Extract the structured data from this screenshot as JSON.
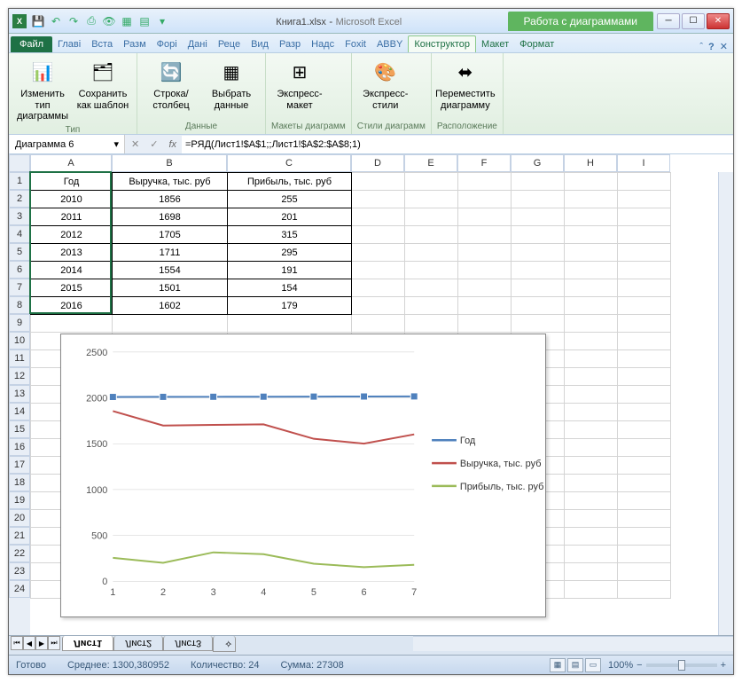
{
  "title": {
    "doc": "Книга1.xlsx",
    "app": "Microsoft Excel",
    "tools": "Работа с диаграммами"
  },
  "qat_icons": [
    "save-icon",
    "undo-icon",
    "redo-icon",
    "print-icon",
    "preview-icon",
    "new-icon",
    "open-icon",
    "more-icon"
  ],
  "tabs": {
    "file": "Файл",
    "list": [
      "Главі",
      "Вста",
      "Разм",
      "Форі",
      "Дані",
      "Реце",
      "Вид",
      "Разр",
      "Надс",
      "Foxit",
      "ABBY"
    ],
    "ctx": [
      "Конструктор",
      "Макет",
      "Формат"
    ]
  },
  "ribbon": {
    "g1": {
      "label": "Тип",
      "b1": "Изменить тип диаграммы",
      "b2": "Сохранить как шаблон"
    },
    "g2": {
      "label": "Данные",
      "b1": "Строка/столбец",
      "b2": "Выбрать данные"
    },
    "g3": {
      "label": "Макеты диаграмм",
      "b1": "Экспресс-макет"
    },
    "g4": {
      "label": "Стили диаграмм",
      "b1": "Экспресс-стили"
    },
    "g5": {
      "label": "Расположение",
      "b1": "Переместить диаграмму"
    }
  },
  "namebox": "Диаграмма 6",
  "formula": "=РЯД(Лист1!$A$1;;Лист1!$A$2:$A$8;1)",
  "columns": [
    "A",
    "B",
    "C",
    "D",
    "E",
    "F",
    "G",
    "H",
    "I"
  ],
  "rows": [
    "1",
    "2",
    "3",
    "4",
    "5",
    "6",
    "7",
    "8",
    "9",
    "10",
    "11",
    "12",
    "13",
    "14",
    "15",
    "16",
    "17",
    "18",
    "19",
    "20",
    "21",
    "22",
    "23",
    "24"
  ],
  "table": {
    "headers": [
      "Год",
      "Выручка, тыс. руб",
      "Прибыль, тыс. руб"
    ],
    "rows": [
      [
        "2010",
        "1856",
        "255"
      ],
      [
        "2011",
        "1698",
        "201"
      ],
      [
        "2012",
        "1705",
        "315"
      ],
      [
        "2013",
        "1711",
        "295"
      ],
      [
        "2014",
        "1554",
        "191"
      ],
      [
        "2015",
        "1501",
        "154"
      ],
      [
        "2016",
        "1602",
        "179"
      ]
    ]
  },
  "chart_data": {
    "type": "line",
    "x": [
      1,
      2,
      3,
      4,
      5,
      6,
      7
    ],
    "series": [
      {
        "name": "Год",
        "values": [
          2010,
          2011,
          2012,
          2013,
          2014,
          2015,
          2016
        ],
        "color": "#4f81bd"
      },
      {
        "name": "Выручка, тыс. руб",
        "values": [
          1856,
          1698,
          1705,
          1711,
          1554,
          1501,
          1602
        ],
        "color": "#c0504d"
      },
      {
        "name": "Прибыль, тыс. руб",
        "values": [
          255,
          201,
          315,
          295,
          191,
          154,
          179
        ],
        "color": "#9bbb59"
      }
    ],
    "ylim": [
      0,
      2500
    ],
    "yticks": [
      0,
      500,
      1000,
      1500,
      2000,
      2500
    ],
    "legend_pos": "right"
  },
  "sheets": {
    "active": "Лист1",
    "list": [
      "Лист1",
      "Лист2",
      "Лист3"
    ]
  },
  "status": {
    "ready": "Готово",
    "avg_label": "Среднее:",
    "avg": "1300,380952",
    "count_label": "Количество:",
    "count": "24",
    "sum_label": "Сумма:",
    "sum": "27308",
    "zoom": "100%"
  }
}
